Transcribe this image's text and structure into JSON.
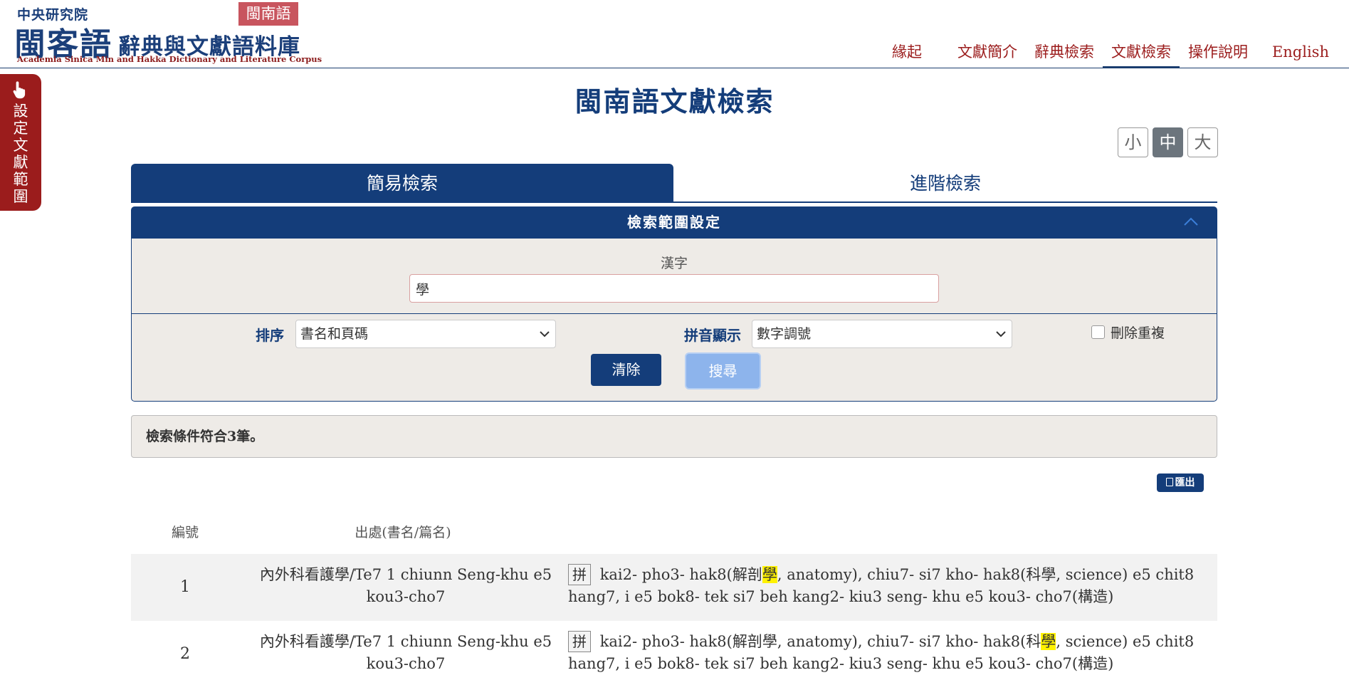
{
  "header": {
    "logo_top": "中央研究院",
    "logo_main": "閩客語",
    "logo_sub": "辭典與文獻語料庫",
    "logo_en": "Academia Sinica Min and Hakka Dictionary and Literature Corpus",
    "lang_badge": "閩南語",
    "nav": [
      {
        "label": "緣起"
      },
      {
        "label": "文獻簡介"
      },
      {
        "label": "辭典檢索"
      },
      {
        "label": "文獻檢索",
        "active": true
      },
      {
        "label": "操作說明"
      },
      {
        "label": "English"
      }
    ]
  },
  "side_tab": {
    "label": "設定文獻範圍"
  },
  "page_title": "閩南語文獻檢索",
  "font_sizes": [
    {
      "label": "小"
    },
    {
      "label": "中",
      "active": true
    },
    {
      "label": "大"
    }
  ],
  "tabs": [
    {
      "label": "簡易檢索",
      "active": true
    },
    {
      "label": "進階檢索"
    }
  ],
  "search_range": {
    "title": "檢索範圍設定",
    "hanzi_label": "漢字",
    "hanzi_value": "學",
    "sort_label": "排序",
    "sort_value": "書名和頁碼",
    "pinyin_label": "拼音顯示",
    "pinyin_value": "數字調號",
    "dedup_label": "刪除重複",
    "dedup_checked": false,
    "clear_label": "清除",
    "search_label": "搜尋"
  },
  "result_summary": "檢索條件符合3筆。",
  "export_label": "匯出",
  "table": {
    "headers": {
      "num": "編號",
      "source": "出處(書名/篇名)"
    },
    "rows": [
      {
        "num": "1",
        "source": "內外科看護學/Te7 1 chiunn Seng-khu e5 kou3-cho7",
        "badge": "拼",
        "text_before": "kai2- pho3- hak8(解剖",
        "highlight": "學",
        "text_after": ", anatomy), chiu7- si7 kho- hak8(科學, science) e5 chit8 hang7, i e5 bok8- tek si7 beh kang2- kiu3 seng- khu e5 kou3- cho7(構造)"
      },
      {
        "num": "2",
        "source": "內外科看護學/Te7 1 chiunn Seng-khu e5 kou3-cho7",
        "badge": "拼",
        "text_before": "kai2- pho3- hak8(解剖學, anatomy), chiu7- si7 kho- hak8(科",
        "highlight": "學",
        "text_after": ", science) e5 chit8 hang7, i e5 bok8- tek si7 beh kang2- kiu3 seng- khu e5 kou3- cho7(構造)"
      }
    ]
  },
  "colors": {
    "brand_blue": "#143d7a",
    "brand_red": "#9b1c1c",
    "highlight": "#fff200"
  }
}
